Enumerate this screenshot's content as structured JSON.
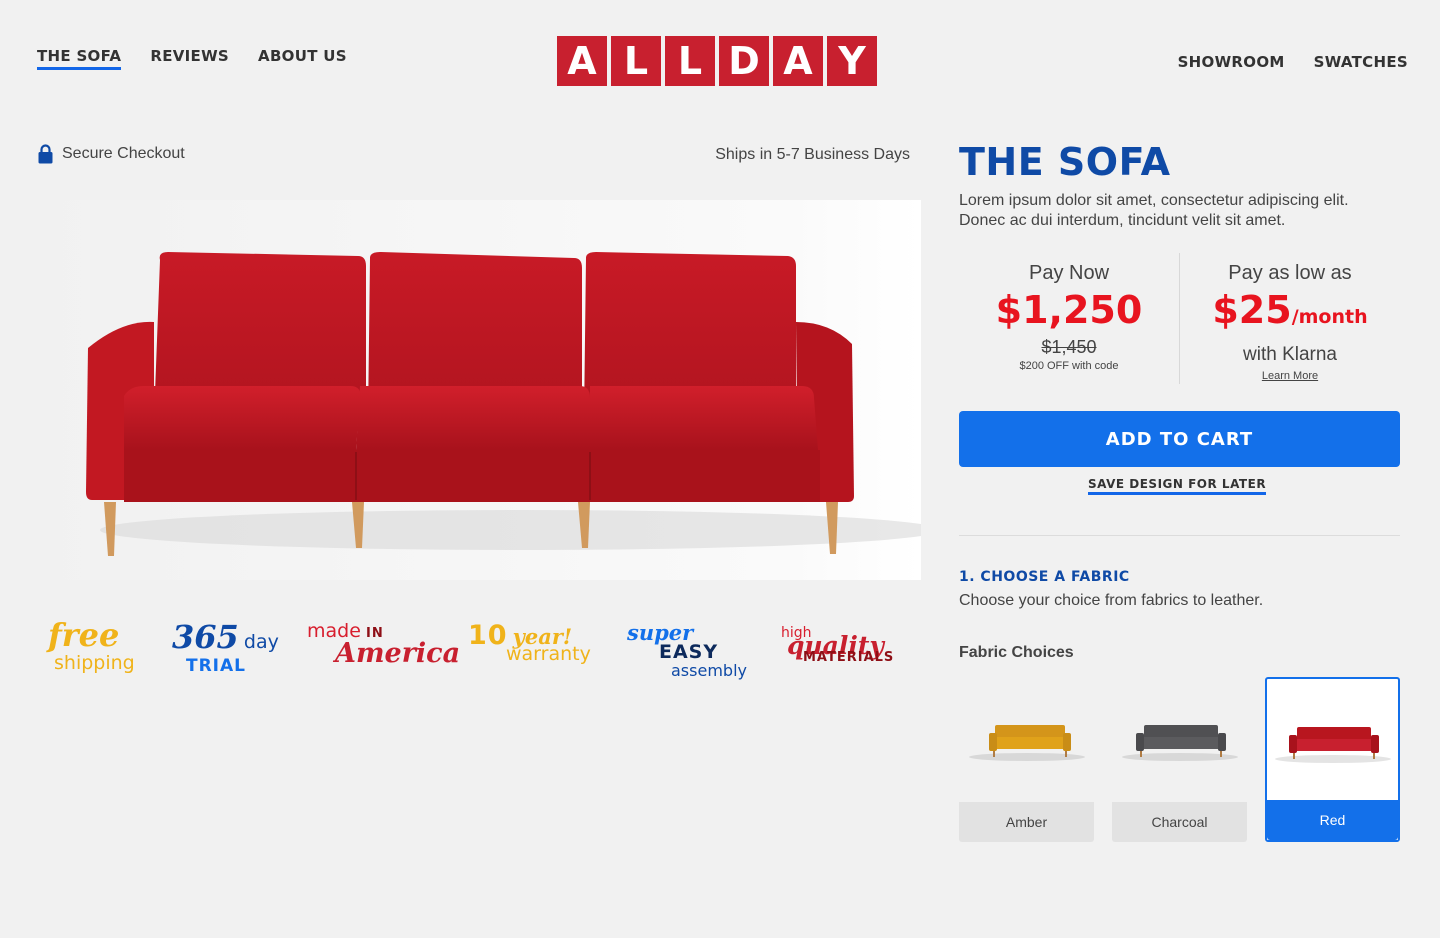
{
  "nav": {
    "left": [
      "THE SOFA",
      "REVIEWS",
      "ABOUT US"
    ],
    "right": [
      "SHOWROOM",
      "SWATCHES"
    ]
  },
  "brand": {
    "letters": [
      "A",
      "L",
      "L",
      "D",
      "A",
      "Y"
    ],
    "color": "#c8202f"
  },
  "checkout": {
    "secure": "Secure Checkout",
    "ships": "Ships in 5-7 Business Days"
  },
  "perks": {
    "free": "free",
    "shipping": "shipping",
    "days": "365",
    "day": "day",
    "trial": "TRIAL",
    "made": "made",
    "in": "IN",
    "america": "America",
    "ten": "10",
    "year": "year!",
    "warranty": "warranty",
    "super": "super",
    "easy": "EASY",
    "assembly": "assembly",
    "high": "high",
    "quality": "quality",
    "materials": "MATERIALS"
  },
  "product": {
    "title": "THE SOFA",
    "description": "Lorem ipsum dolor sit amet, consectetur adipiscing elit. Donec ac dui interdum, tincidunt velit sit amet."
  },
  "pricing": {
    "pay_now_label": "Pay Now",
    "pay_now_price": "$1,250",
    "original_price": "$1,450",
    "discount_note": "$200 OFF with code",
    "low_label": "Pay as low as",
    "low_price": "$25",
    "low_suffix": "/month",
    "klarna": "with Klarna",
    "learn_more": "Learn More"
  },
  "actions": {
    "add_to_cart": "ADD TO CART",
    "save_later": "SAVE DESIGN FOR LATER"
  },
  "fabric": {
    "step_title": "1.  CHOOSE A FABRIC",
    "step_desc": "Choose your choice from fabrics to leather.",
    "label": "Fabric Choices",
    "options": [
      {
        "name": "Amber",
        "color": "#e0a21a"
      },
      {
        "name": "Charcoal",
        "color": "#5b5b5e"
      },
      {
        "name": "Red",
        "color": "#c8202f",
        "selected": true
      }
    ]
  },
  "colors": {
    "accent": "#1370ea",
    "title_blue": "#0f4aa6",
    "price_red": "#e8141f"
  }
}
